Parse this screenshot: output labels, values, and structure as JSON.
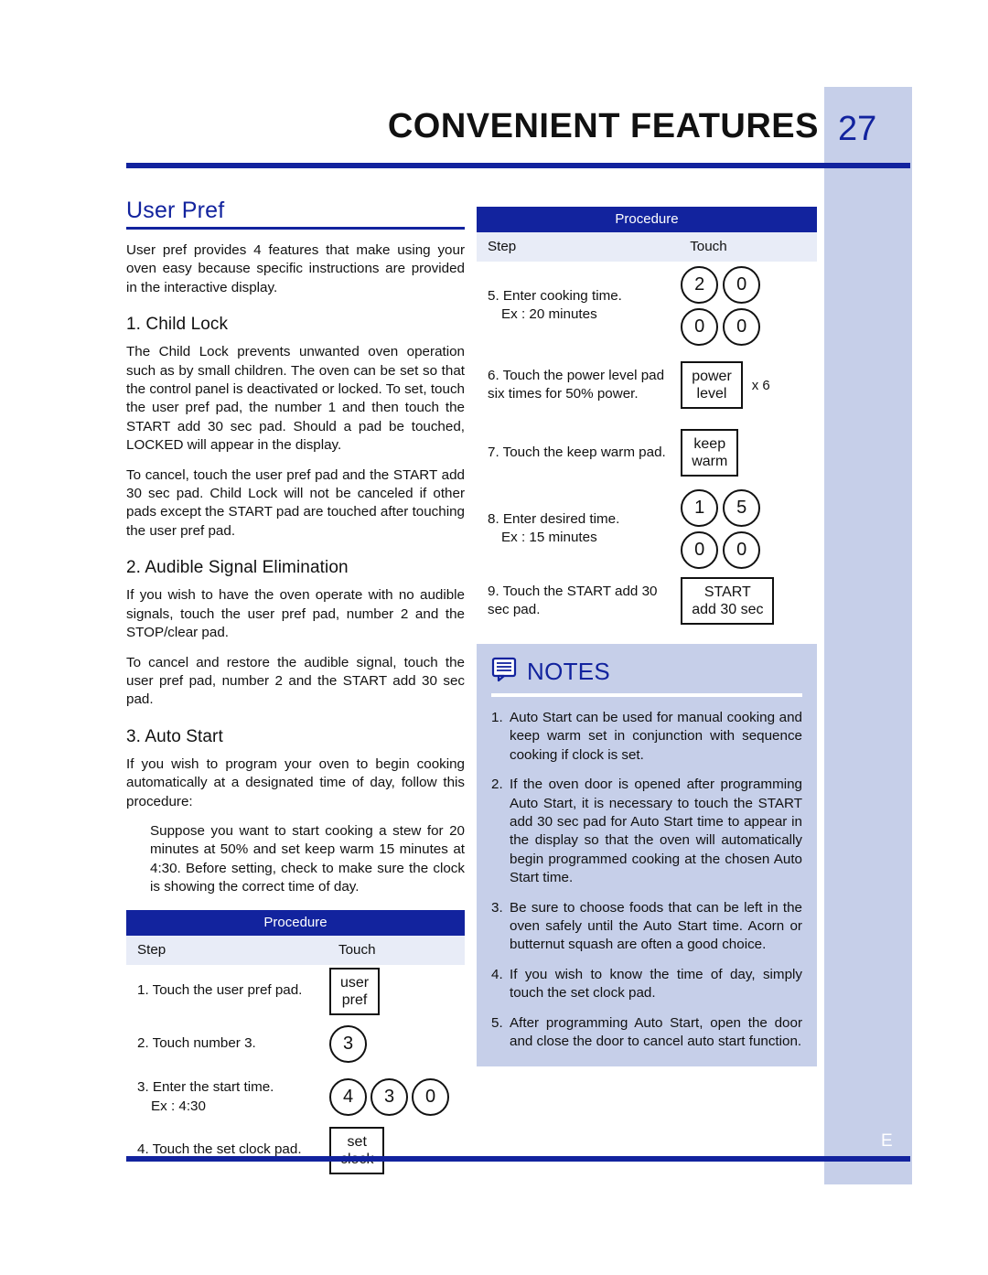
{
  "header": {
    "title": "CONVENIENT FEATURES",
    "page_number": "27"
  },
  "edge": {
    "letter": "E"
  },
  "left_column": {
    "section_title": "User Pref",
    "intro": "User pref provides 4 features that make using your oven easy because specific instructions are provided in the interactive display.",
    "subsections": [
      {
        "heading": "1. Child Lock",
        "paragraphs": [
          "The Child Lock prevents unwanted oven operation such as by small children. The oven can be set so that the control panel is deactivated or locked. To set, touch the user pref  pad, the number 1 and then touch the START add 30 sec  pad. Should a pad be touched, LOCKED will appear in the display.",
          "To cancel, touch the user pref  pad and the START add 30 sec  pad. Child Lock will not be canceled if other pads except the START pad are touched after touching the user pref  pad."
        ]
      },
      {
        "heading": "2. Audible Signal Elimination",
        "paragraphs": [
          "If you wish to have the oven operate with no audible signals, touch the user pref  pad, number 2 and the STOP/clear  pad.",
          "To cancel and restore the audible signal, touch the user pref  pad, number 2 and the START add 30 sec  pad."
        ]
      },
      {
        "heading": "3. Auto Start",
        "paragraphs": [
          "If you wish to program your oven to begin cooking automatically at a designated time of day, follow this procedure:"
        ],
        "indented": "Suppose you want to start cooking a stew for 20 minutes at 50% and set keep warm 15 minutes at 4:30. Before setting, check to make sure the clock is showing the correct time of day."
      }
    ],
    "procedure": {
      "title": "Procedure",
      "col_step": "Step",
      "col_touch": "Touch",
      "rows": [
        {
          "step": "1. Touch the user pref  pad.",
          "sub": "",
          "keys": [
            {
              "type": "box",
              "lines": [
                "user",
                "pref"
              ]
            }
          ],
          "multiplier": ""
        },
        {
          "step": "2. Touch number 3.",
          "sub": "",
          "keys": [
            {
              "type": "circle",
              "label": "3"
            }
          ],
          "multiplier": ""
        },
        {
          "step": "3. Enter the start time.",
          "sub": "Ex : 4:30",
          "keys": [
            {
              "type": "circle",
              "label": "4"
            },
            {
              "type": "circle",
              "label": "3"
            },
            {
              "type": "circle",
              "label": "0"
            }
          ],
          "multiplier": ""
        },
        {
          "step": "4. Touch the set clock  pad.",
          "sub": "",
          "keys": [
            {
              "type": "box",
              "lines": [
                "set",
                "clock"
              ]
            }
          ],
          "multiplier": ""
        }
      ]
    }
  },
  "right_column": {
    "procedure": {
      "title": "Procedure",
      "col_step": "Step",
      "col_touch": "Touch",
      "rows": [
        {
          "step": "5. Enter cooking time.",
          "sub": "Ex : 20 minutes",
          "grid": [
            [
              "2",
              "0"
            ],
            [
              "0",
              "0"
            ]
          ],
          "multiplier": ""
        },
        {
          "step": "6. Touch the power level pad six times for 50% power.",
          "sub": "",
          "keys": [
            {
              "type": "box",
              "lines": [
                "power",
                "level"
              ]
            }
          ],
          "multiplier": "x 6"
        },
        {
          "step": "7. Touch the keep warm pad.",
          "sub": "",
          "keys": [
            {
              "type": "box",
              "lines": [
                "keep",
                "warm"
              ]
            }
          ],
          "multiplier": ""
        },
        {
          "step": "8. Enter desired time.",
          "sub": "Ex : 15 minutes",
          "grid": [
            [
              "1",
              "5"
            ],
            [
              "0",
              "0"
            ]
          ],
          "multiplier": ""
        },
        {
          "step": "9. Touch the START add 30 sec pad.",
          "sub": "",
          "keys": [
            {
              "type": "box",
              "lines": [
                "START",
                "add 30 sec"
              ]
            }
          ],
          "multiplier": ""
        }
      ]
    },
    "notes": {
      "title": "NOTES",
      "icon": "notes-bubble-icon",
      "items": [
        {
          "num": "1.",
          "text": "Auto Start can be used for manual cooking and keep warm set in conjunction with sequence cooking if clock is set."
        },
        {
          "num": "2.",
          "text": "If the oven door is opened after programming Auto Start, it is necessary to touch the START add 30 sec  pad for Auto Start time to appear in the display so that the oven will automatically begin programmed cooking at the chosen Auto Start time."
        },
        {
          "num": "3.",
          "text": "Be sure to choose foods that can be left in the oven safely until the Auto Start time. Acorn or butternut squash are often a good choice."
        },
        {
          "num": "4.",
          "text": "If you wish to know the time of day, simply touch the set clock  pad."
        },
        {
          "num": "5.",
          "text": "After programming Auto Start, open the door and close the door to cancel auto start function."
        }
      ]
    }
  },
  "colors": {
    "brand_blue": "#12239e",
    "tint_blue": "#c6cfe9",
    "subheader_blue": "#e8ecf7"
  }
}
